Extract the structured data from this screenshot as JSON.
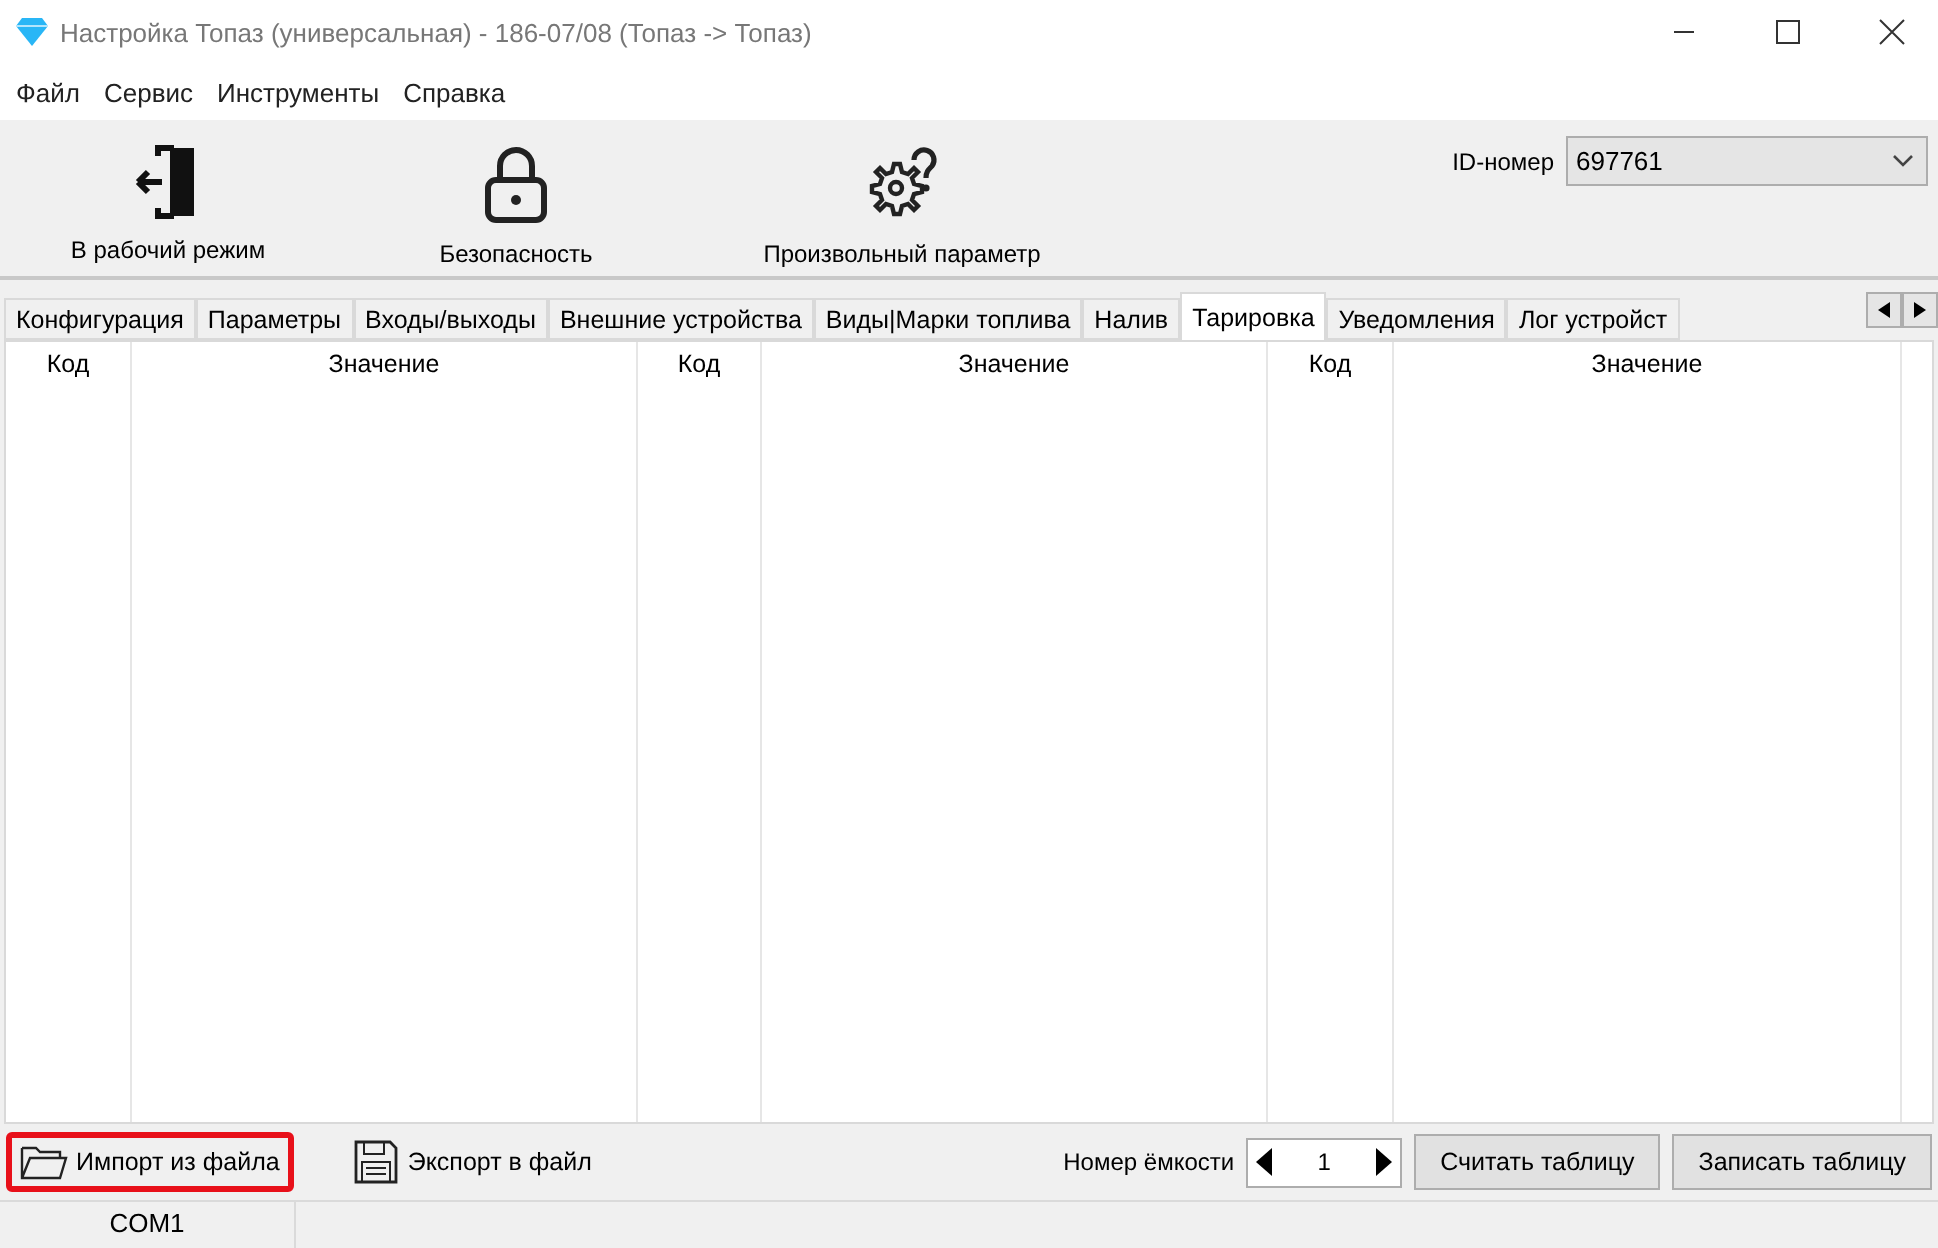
{
  "window": {
    "title": "Настройка Топаз (универсальная) - 186-07/08 (Топаз -> Топаз)"
  },
  "menu": [
    "Файл",
    "Сервис",
    "Инструменты",
    "Справка"
  ],
  "toolbar": [
    {
      "kind": "exit",
      "label": "В рабочий режим"
    },
    {
      "kind": "lock",
      "label": "Безопасность"
    },
    {
      "kind": "gear",
      "label": "Произвольный параметр"
    }
  ],
  "id_field": {
    "label": "ID-номер",
    "value": "697761"
  },
  "tabs": [
    {
      "label": "Конфигурация",
      "selected": false
    },
    {
      "label": "Параметры",
      "selected": false
    },
    {
      "label": "Входы/выходы",
      "selected": false
    },
    {
      "label": "Внешние устройства",
      "selected": false
    },
    {
      "label": "Виды|Марки топлива",
      "selected": false
    },
    {
      "label": "Налив",
      "selected": false
    },
    {
      "label": "Тарировка",
      "selected": true
    },
    {
      "label": "Уведомления",
      "selected": false
    },
    {
      "label": "Лог устройст",
      "selected": false
    }
  ],
  "table": {
    "columns": [
      "Код",
      "Значение",
      "Код",
      "Значение",
      "Код",
      "Значение"
    ]
  },
  "bottom": {
    "import": {
      "label": "Импорт из файла",
      "highlighted": true
    },
    "export": {
      "label": "Экспорт в файл"
    },
    "tank_label": "Номер ёмкости",
    "tank_value": "1",
    "buttons": [
      "Считать таблицу",
      "Записать таблицу"
    ]
  },
  "status_bar": {
    "port": "COM1"
  }
}
